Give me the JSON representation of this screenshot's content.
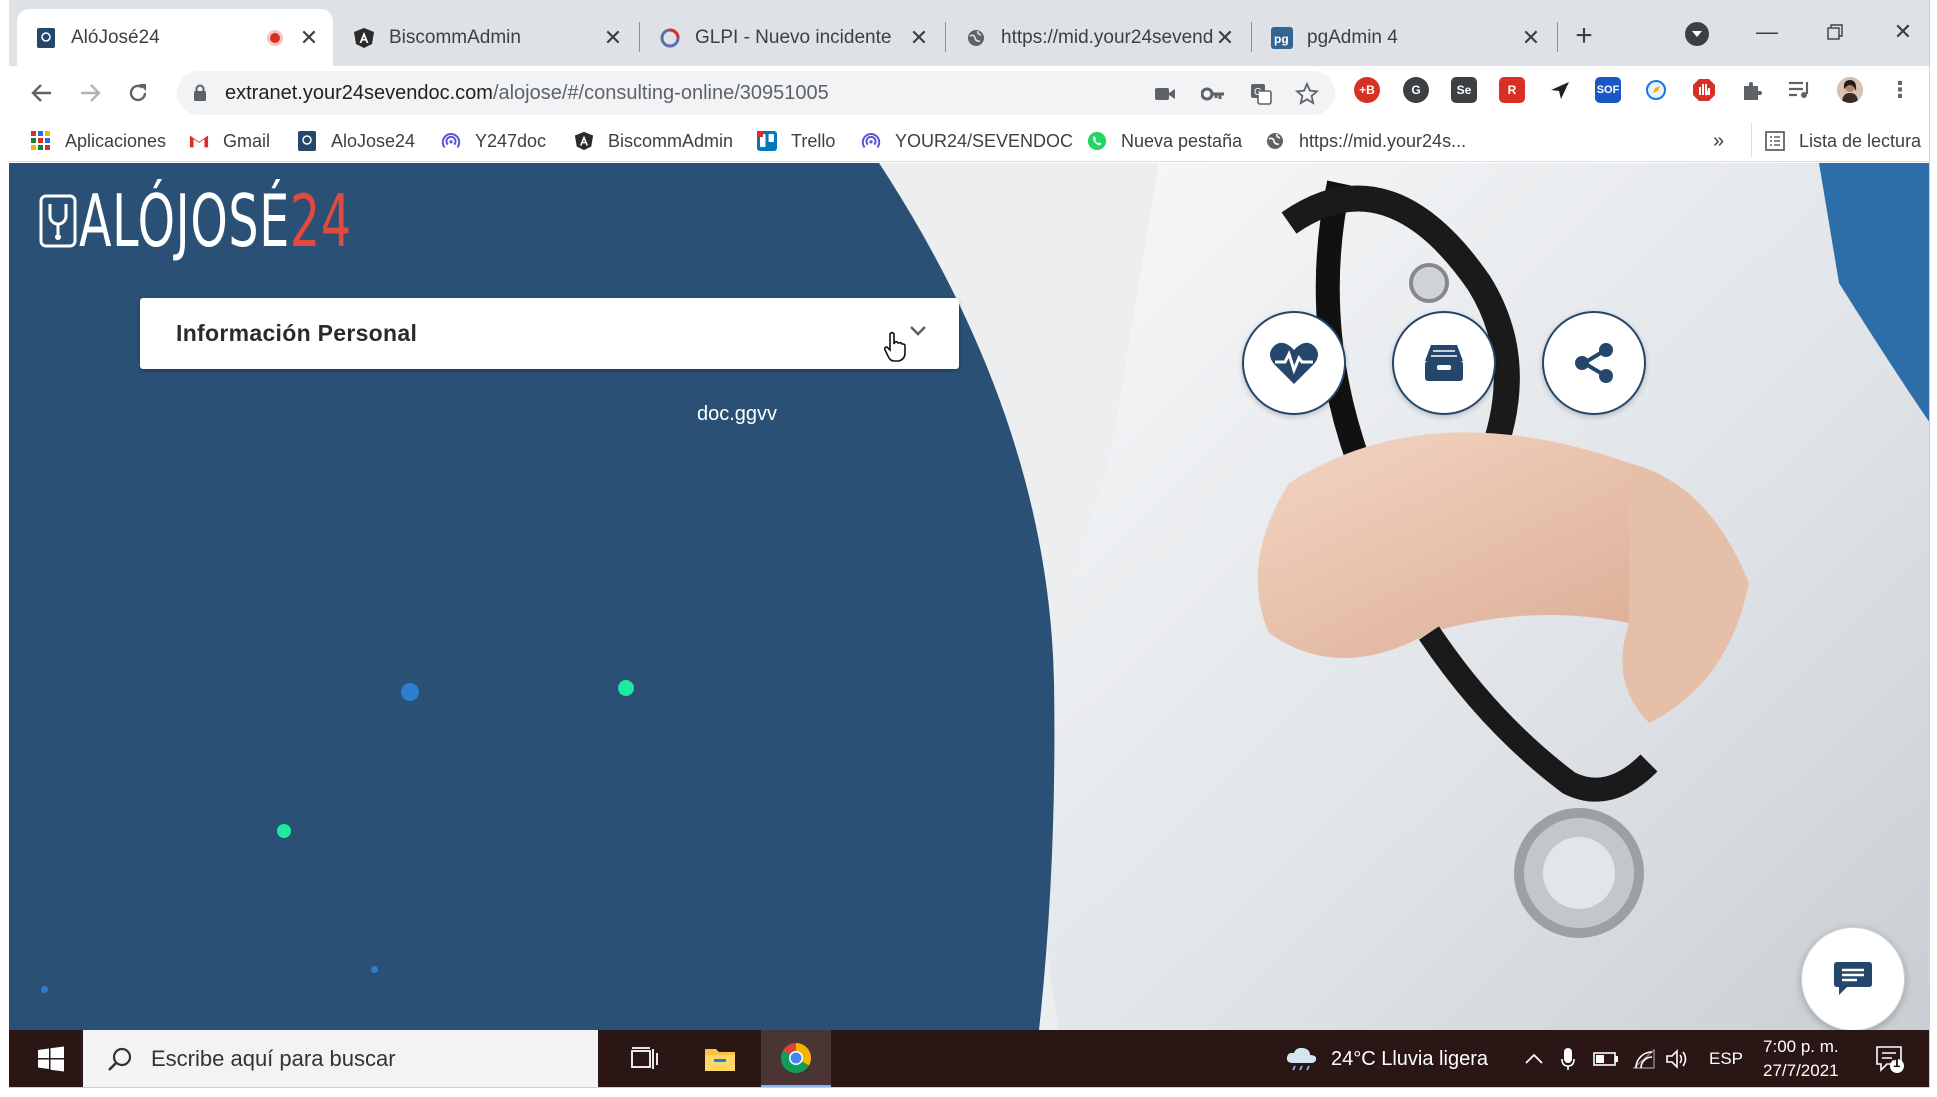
{
  "browser": {
    "tabs": [
      {
        "title": "AlóJosé24",
        "active": true,
        "recording": true
      },
      {
        "title": "BiscommAdmin",
        "active": false
      },
      {
        "title": "GLPI - Nuevo incidente",
        "active": false
      },
      {
        "title": "https://mid.your24sevendoc",
        "active": false
      },
      {
        "title": "pgAdmin 4",
        "active": false
      }
    ],
    "new_tab": "+",
    "url_host": "extranet.your24sevendoc.com",
    "url_path": "/alojose/#/consulting-online/30951005",
    "bookmarks": [
      {
        "label": "Aplicaciones"
      },
      {
        "label": "Gmail"
      },
      {
        "label": "AloJose24"
      },
      {
        "label": "Y247doc"
      },
      {
        "label": "BiscommAdmin"
      },
      {
        "label": "Trello"
      },
      {
        "label": "YOUR24/SEVENDOC"
      },
      {
        "label": "Nueva pestaña"
      },
      {
        "label": "https://mid.your24s..."
      }
    ],
    "more_bookmarks": "»",
    "reading_list": "Lista de lectura",
    "extensions": [
      {
        "label": "+B",
        "color": "#d93025"
      },
      {
        "label": "G",
        "color": "#3c4043"
      },
      {
        "label": "Se",
        "color": "#3c4043"
      },
      {
        "label": "R",
        "color": "#d93025"
      },
      {
        "label": "SOF",
        "color": "#1a56c4"
      },
      {
        "label": "●",
        "color": "#e8f0fe"
      },
      {
        "label": "✋",
        "color": "#d93025"
      }
    ]
  },
  "page": {
    "logo_text": "ALÓJOSÉ",
    "logo_num": "24",
    "card_title": "Información Personal",
    "user_label": "doc.ggvv",
    "colors": {
      "blue": "#2a5075",
      "accent": "#e04a3f",
      "dark_icon": "#24476b",
      "dot_green": "#1de9a0",
      "dot_blue": "#2c7fd0"
    }
  },
  "taskbar": {
    "search_placeholder": "Escribe aquí para buscar",
    "weather": "24°C  Lluvia ligera",
    "lang": "ESP",
    "time": "7:00 p. m.",
    "date": "27/7/2021",
    "notifications": "1"
  }
}
